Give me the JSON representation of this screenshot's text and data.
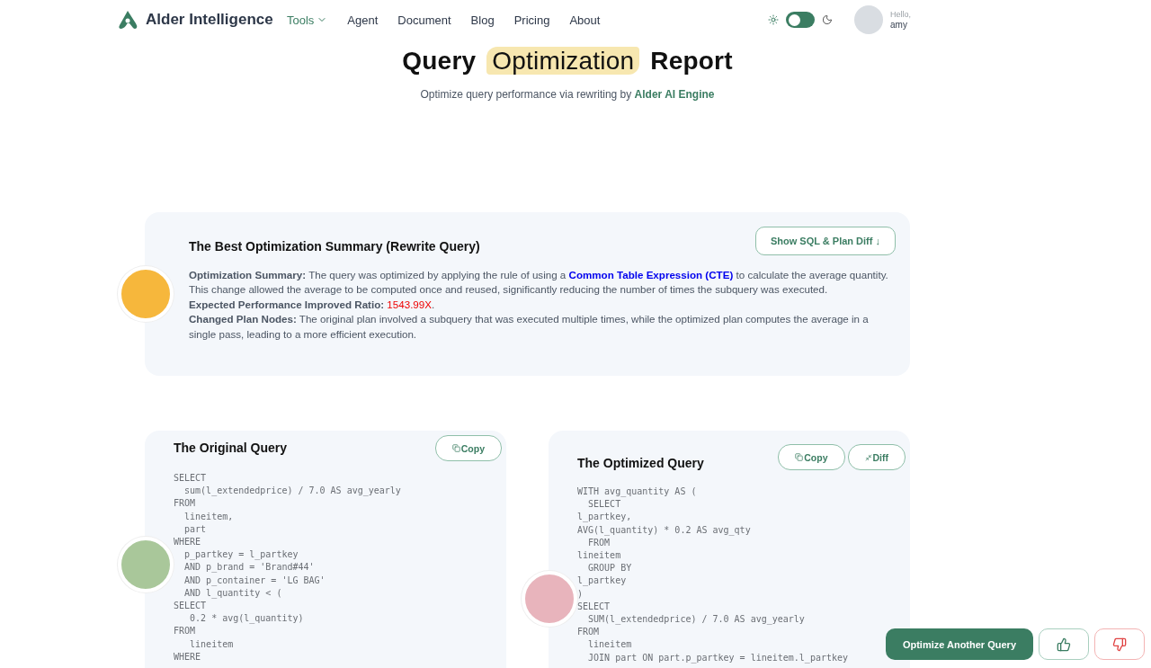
{
  "brand": {
    "name": "Alder Intelligence"
  },
  "nav": [
    {
      "label": "Tools",
      "selected": true,
      "dropdown": true
    },
    {
      "label": "Agent",
      "selected": false,
      "dropdown": false
    },
    {
      "label": "Document",
      "selected": false,
      "dropdown": false
    },
    {
      "label": "Blog",
      "selected": false,
      "dropdown": false
    },
    {
      "label": "Pricing",
      "selected": false,
      "dropdown": false
    },
    {
      "label": "About",
      "selected": false,
      "dropdown": false
    }
  ],
  "theme_toggle": {
    "on": false
  },
  "user": {
    "greeting": "Hello,",
    "name": "amy"
  },
  "hero": {
    "title_before": "Query",
    "title_highlight": "Optimization",
    "title_after": "Report",
    "subtitle": "Optimize query performance via rewriting by",
    "subtitle_link": "Alder AI Engine"
  },
  "summary": {
    "title": "The Best Optimization Summary (Rewrite Query)",
    "button": "Show SQL & Plan Diff ↓",
    "items": [
      {
        "kind": "text",
        "label": "Optimization Summary:",
        "text": "The query was optimized by applying the rule of using a",
        "link": "Common Table Expression (CTE)",
        "text_after": "to calculate the average quantity. This change allowed the average to be computed once and reused, significantly reducing the number of times the subquery was executed."
      },
      {
        "kind": "ratio",
        "label": "Expected Performance Improved Ratio:",
        "value": "1543.99X",
        "text_after": "."
      },
      {
        "kind": "text",
        "label": "Changed Plan Nodes:",
        "text": "The original plan involved a subquery that was executed multiple times, while the optimized plan computes the average in a single pass, leading to a more efficient execution."
      }
    ]
  },
  "original": {
    "title": "The Original Query",
    "buttons": [
      {
        "kind": "copy",
        "label": "Copy"
      }
    ],
    "code": [
      "SELECT",
      "  sum(l_extendedprice) / 7.0 AS avg_yearly",
      "FROM",
      "  lineitem,",
      "  part",
      "WHERE",
      "  p_partkey = l_partkey",
      "  AND p_brand = 'Brand#44'",
      "  AND p_container = 'LG BAG'",
      "  AND l_quantity < (",
      "SELECT",
      "   0.2 * avg(l_quantity)",
      "FROM",
      "   lineitem",
      "WHERE"
    ]
  },
  "optimized": {
    "title": "The Optimized Query",
    "buttons": [
      {
        "kind": "copy",
        "label": "Copy"
      },
      {
        "kind": "diff",
        "label": "Diff"
      }
    ],
    "code": [
      "WITH avg_quantity AS (",
      "  SELECT",
      "l_partkey,",
      "AVG(l_quantity) * 0.2 AS avg_qty",
      "  FROM",
      "lineitem",
      "  GROUP BY",
      "l_partkey",
      ")",
      "SELECT",
      "  SUM(l_extendedprice) / 7.0 AS avg_yearly",
      "FROM",
      "  lineitem",
      "  JOIN part ON part.p_partkey = lineitem.l_partkey"
    ]
  },
  "footer_actions": {
    "primary": "Optimize Another Query"
  }
}
